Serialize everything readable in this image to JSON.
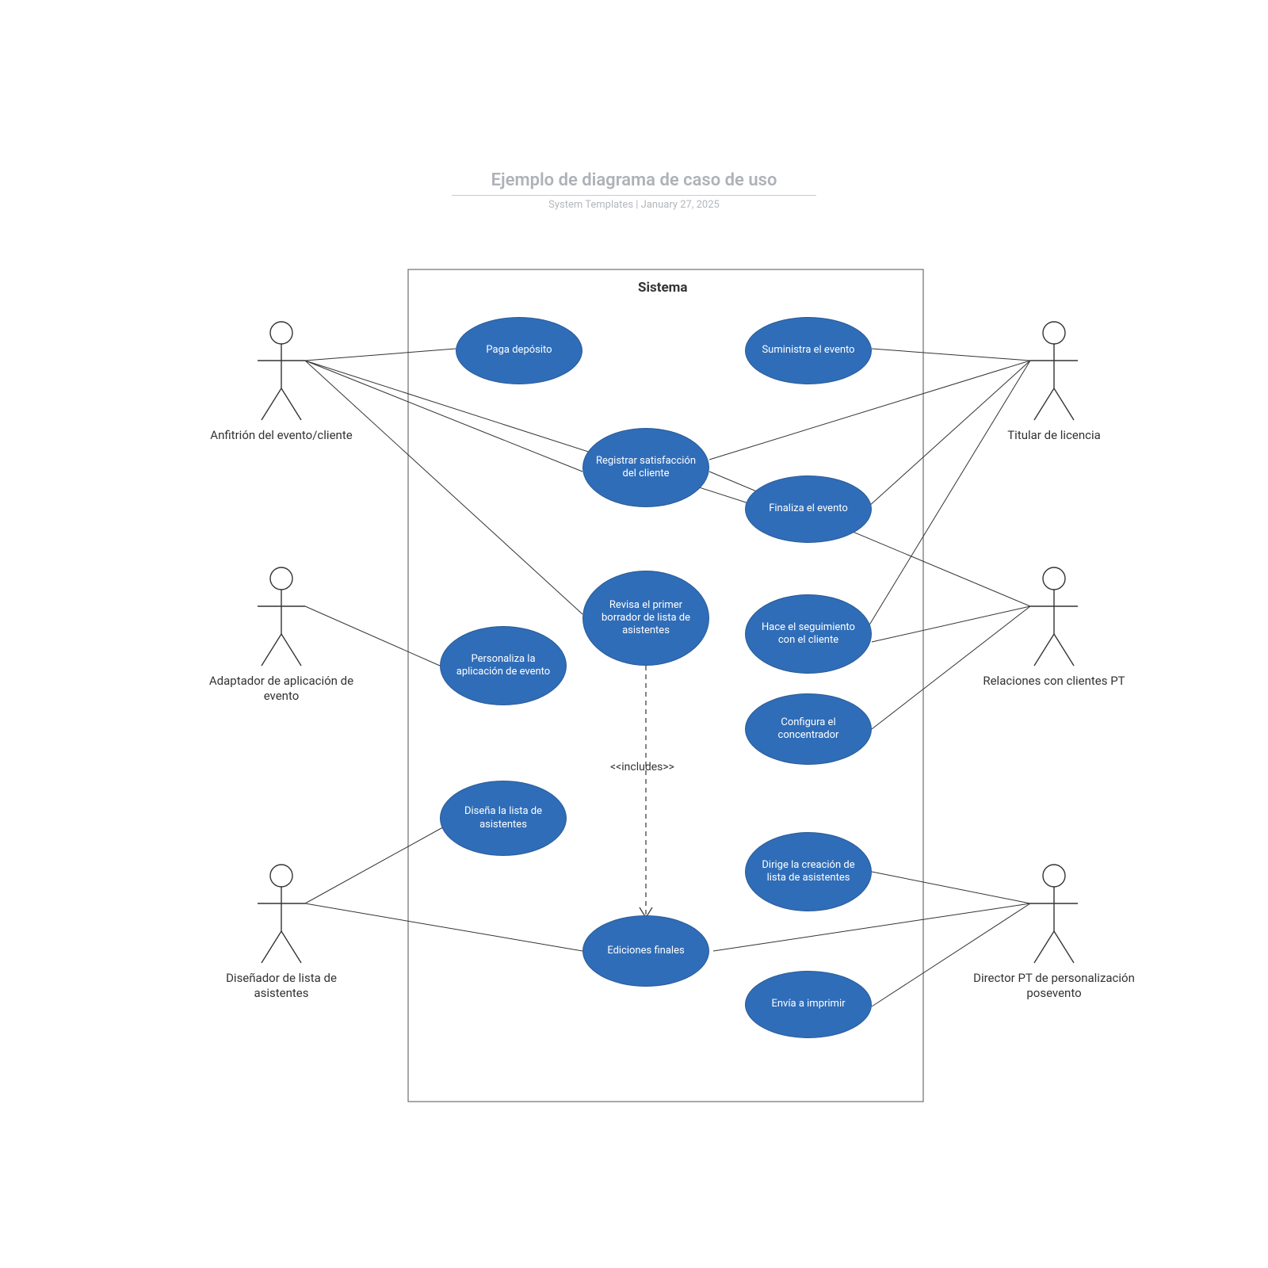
{
  "title": "Ejemplo de diagrama de caso de uso",
  "subtitle_author": "System Templates",
  "subtitle_divider": "  |  ",
  "subtitle_date": "January 27, 2025",
  "system_label": "Sistema",
  "includes_label": "<<includes>>",
  "actors": {
    "host": "Anfitrión del evento/cliente",
    "adapter": "Adaptador de aplicación de evento",
    "designer": "Diseñador de lista de asistentes",
    "licensee": "Titular de licencia",
    "pt_rel": "Relaciones con clientes PT",
    "pt_dir": "Director PT de personalización posevento"
  },
  "usecases": {
    "uc_pay": "Paga depósito",
    "uc_supply": "Suministra el evento",
    "uc_satisf": "Registrar satisfacción del cliente",
    "uc_finalize": "Finaliza el evento",
    "uc_review": "Revisa el primer borrador de lista de asistentes",
    "uc_followup": "Hace el seguimiento con el cliente",
    "uc_customize": "Personaliza la aplicación de evento",
    "uc_confighub": "Configura el concentrador",
    "uc_designlist": "Diseña la lista de asistentes",
    "uc_direct": "Dirige la creación de lista de asistentes",
    "uc_final_ed": "Ediciones finales",
    "uc_print": "Envía a imprimir"
  }
}
